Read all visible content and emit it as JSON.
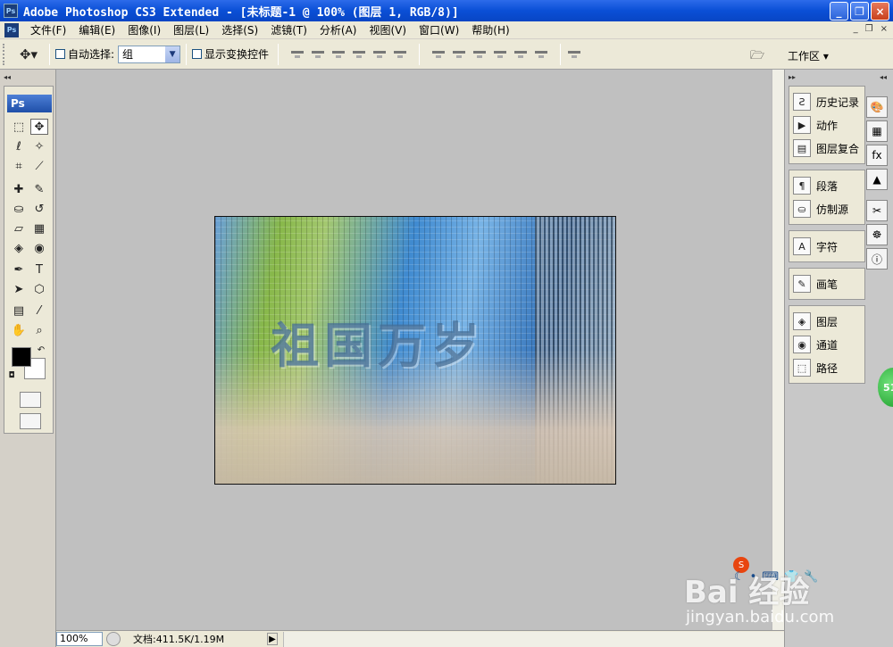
{
  "window": {
    "title": "Adobe Photoshop CS3 Extended - [未标题-1 @ 100% (图层 1, RGB/8)]",
    "app_icon": "Ps",
    "controls": [
      "_",
      "❐",
      "×"
    ]
  },
  "menu": {
    "items": [
      "文件(F)",
      "编辑(E)",
      "图像(I)",
      "图层(L)",
      "选择(S)",
      "滤镜(T)",
      "分析(A)",
      "视图(V)",
      "窗口(W)",
      "帮助(H)"
    ],
    "doc_controls": [
      "_",
      "❐",
      "×"
    ]
  },
  "options": {
    "auto_select_label": "自动选择:",
    "auto_select_value": "组",
    "show_transform_label": "显示变换控件",
    "workspace_label": "工作区 ▾"
  },
  "toolbox": {
    "badge": "Ps"
  },
  "canvas": {
    "text": "祖国万岁"
  },
  "status": {
    "zoom": "100%",
    "doc_info": "文档:411.5K/1.19M",
    "arrow": "▶"
  },
  "panels": {
    "group1": [
      "历史记录",
      "动作",
      "图层复合"
    ],
    "group2": [
      "段落",
      "仿制源"
    ],
    "group3": [
      "字符"
    ],
    "group4": [
      "画笔"
    ],
    "group5": [
      "图层",
      "通道",
      "路径"
    ]
  },
  "badge": {
    "text": "51"
  },
  "watermark": {
    "brand": "Bai 经验",
    "url": "jingyan.baidu.com"
  }
}
